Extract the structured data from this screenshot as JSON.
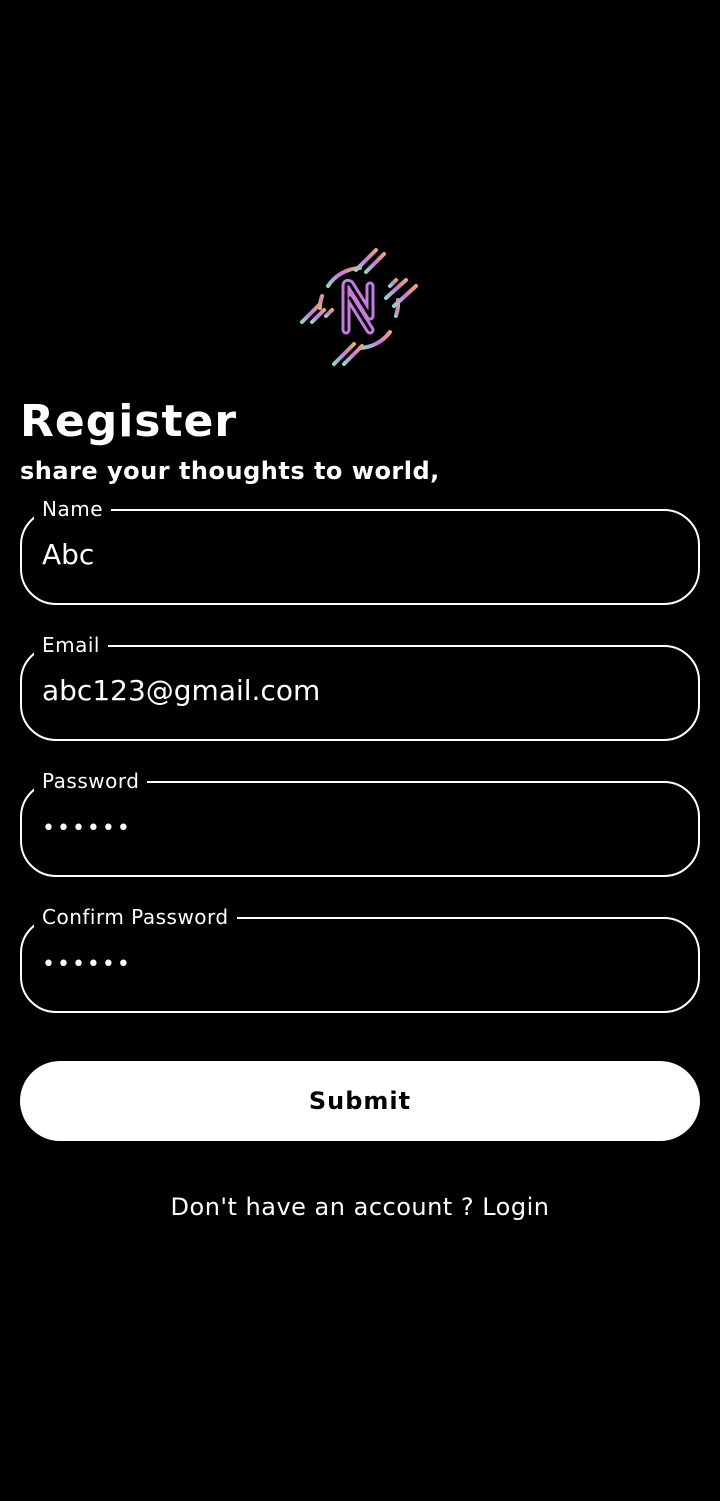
{
  "logo": {
    "letter": "N",
    "icon": "n-logo-icon"
  },
  "header": {
    "title": "Register",
    "subtitle": "share your thoughts to world,"
  },
  "form": {
    "name": {
      "label": "Name",
      "value": "Abc"
    },
    "email": {
      "label": "Email",
      "value": "abc123@gmail.com"
    },
    "password": {
      "label": "Password",
      "value": "••••••"
    },
    "confirm_password": {
      "label": "Confirm Password",
      "value": "••••••"
    },
    "submit_label": "Submit"
  },
  "footer": {
    "prompt": "Don't have an account ? ",
    "link_label": "Login"
  },
  "colors": {
    "background": "#000000",
    "foreground": "#ffffff",
    "logo_gradient": [
      "#f0a36b",
      "#c77ae0",
      "#8fd6c8"
    ]
  }
}
